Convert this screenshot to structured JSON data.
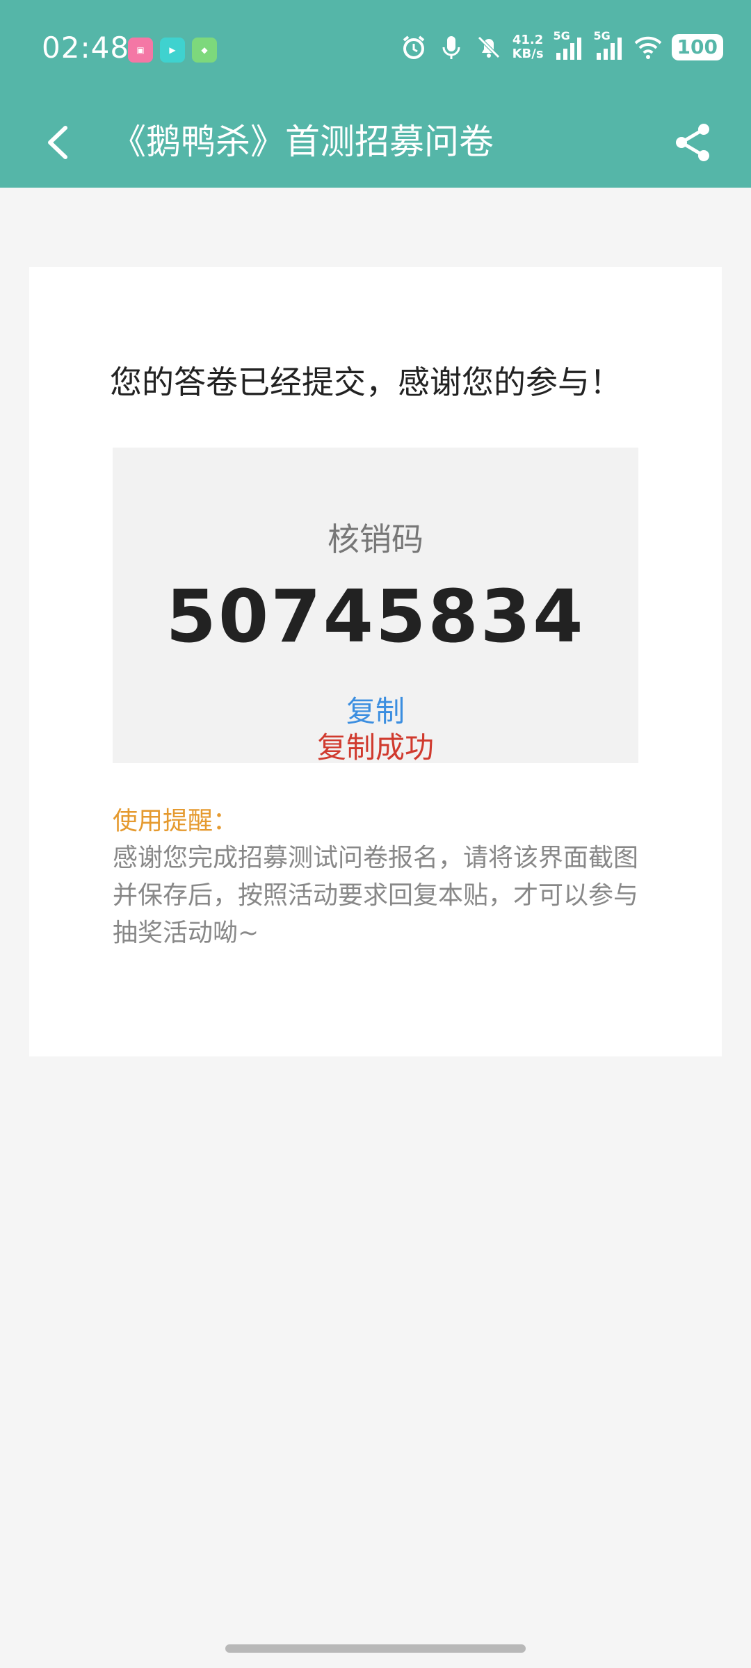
{
  "status_bar": {
    "time": "02:48",
    "net_speed_value": "41.2",
    "net_speed_unit": "KB/s",
    "signal1_label": "5G",
    "signal2_label": "5G",
    "battery": "100"
  },
  "app_bar": {
    "title": "《鹅鸭杀》首测招募问卷"
  },
  "card": {
    "submitted_message": "您的答卷已经提交，感谢您的参与！",
    "code_label": "核销码",
    "code_value": "50745834",
    "copy_label": "复制",
    "copy_success": "复制成功",
    "reminder_title": "使用提醒：",
    "reminder_body": "感谢您完成招募测试问卷报名，请将该界面截图并保存后，按照活动要求回复本贴，才可以参与抽奖活动呦~"
  },
  "colors": {
    "header": "#55b6a8",
    "copy_link": "#3b8ee0",
    "success": "#d03a2e",
    "reminder": "#e59a2f"
  }
}
